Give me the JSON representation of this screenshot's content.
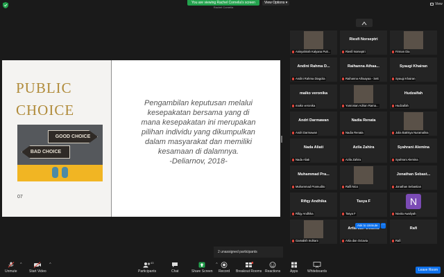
{
  "banner": {
    "viewing_text": "You are viewing Rachel Cornelia's screen",
    "presenter_name": "Rachel Cornelia"
  },
  "view_options_label": "View Options ▾",
  "view_label": "View",
  "slide": {
    "title": "PUBLIC\nCHOICE",
    "sign_good": "GOOD CHOICE",
    "sign_bad": "BAD CHOICE",
    "page_number": "07",
    "quote": "Pengambilan keputusan melalui\nkesepakatan bersama yang di\nmana kesepakatan ini merupakan\npilihan individu yang dikumpulkan\ndalam masyarakat dan memiliki\nkesamaan di dalamnya.\n-Deliarnov, 2018-"
  },
  "participants": [
    {
      "name": "",
      "label": "Anisyahirah Kalyana Putr...",
      "has_photo": true
    },
    {
      "name": "Riesfi Norseptri",
      "label": "Riesfi Norseptri"
    },
    {
      "name": "",
      "label": "Firman Dia",
      "has_photo": true
    },
    {
      "name": "Andini Rahma D...",
      "label": "Andini Rahma Diagcita"
    },
    {
      "name": "Raihanna Athaa...",
      "label": "Raihanna Athaayaa - Sett"
    },
    {
      "name": "Syaugi Khairan",
      "label": "Syaugi Khairan"
    },
    {
      "name": "maiko veronika",
      "label": "maiko veronika"
    },
    {
      "name": "",
      "label": "Yusronian Adrian Rama...",
      "has_photo": true
    },
    {
      "name": "Hudzaifah",
      "label": "Hudzaifah"
    },
    {
      "name": "Andri Darmawan",
      "label": "Andri Darmawan"
    },
    {
      "name": "Nadia Renata",
      "label": "Nadia Renata"
    },
    {
      "name": "",
      "label": "Julia Batrisya Nuramalina",
      "has_photo": true
    },
    {
      "name": "Nada Aliati",
      "label": "Nada Aliati"
    },
    {
      "name": "Azila Zahira",
      "label": "Azila Zahira"
    },
    {
      "name": "Syahrani Alemina",
      "label": "Syahrani Alemina"
    },
    {
      "name": "Muhammad Pra...",
      "label": "Muhammad Pramudito"
    },
    {
      "name": "",
      "label": "Rafli Nico",
      "has_photo": true
    },
    {
      "name": "Jonathan Sebast...",
      "label": "Jonathan Sebastian"
    },
    {
      "name": "Rifqy Andhika",
      "label": "Rifqy Andhika"
    },
    {
      "name": "Tasya F",
      "label": "Tasya F"
    },
    {
      "name": "",
      "label": "Novita Awaliyah",
      "avatar_letter": "N"
    },
    {
      "name": "",
      "label": "Gamalish Indriani",
      "has_photo": true
    },
    {
      "name": "Artia dan Octavia",
      "label": "Artia dan Octavia"
    },
    {
      "name": "Rafi",
      "label": "Rafi"
    }
  ],
  "ask_to_unmute": "Ask to Unmute",
  "ask_more": "···",
  "unassigned": "2 unassigned participants",
  "toolbar": {
    "unmute": "Unmute",
    "start_video": "Start Video",
    "participants": "Participants",
    "participants_count": "43",
    "chat": "Chat",
    "share_screen": "Share Screen",
    "record": "Record",
    "breakout_rooms": "Breakout Rooms",
    "reactions": "Reactions",
    "apps": "Apps",
    "whiteboards": "Whiteboards",
    "leave": "Leave Room"
  },
  "colors": {
    "banner_green": "#23a24d",
    "accent_blue": "#0e71eb",
    "title_gold": "#b08b3a",
    "mute_red": "#e0453b"
  }
}
